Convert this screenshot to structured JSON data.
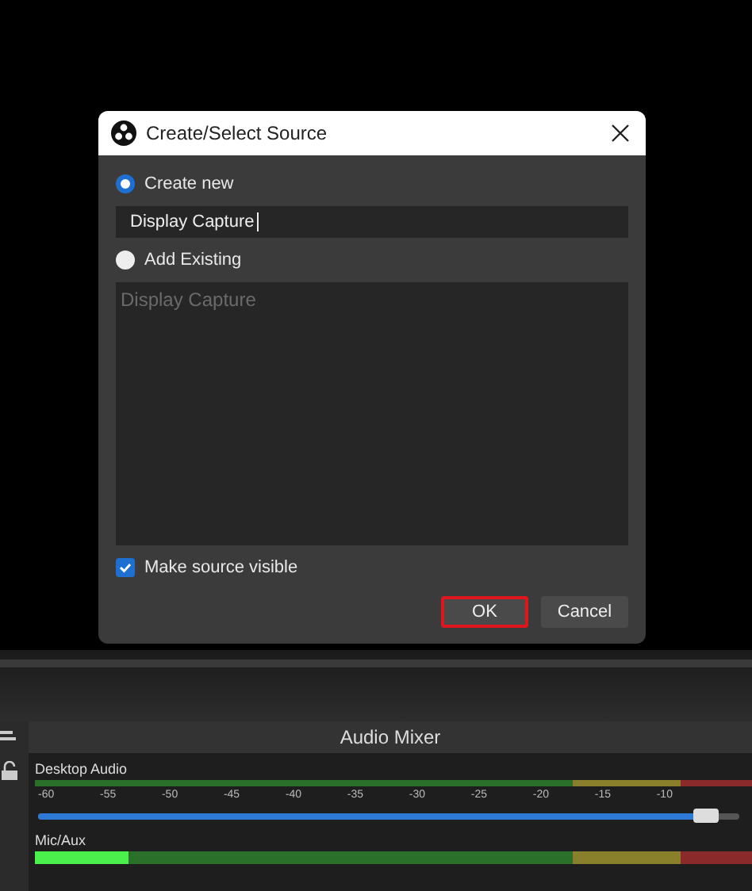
{
  "dialog": {
    "title": "Create/Select Source",
    "options": [
      {
        "label": "Create new",
        "selected": true
      },
      {
        "label": "Add Existing",
        "selected": false
      }
    ],
    "name_field": {
      "value": "Display Capture"
    },
    "existing_list": {
      "disabled": true,
      "items": [
        "Display Capture"
      ]
    },
    "make_visible": {
      "label": "Make source visible",
      "checked": true
    },
    "buttons": [
      {
        "label": "OK",
        "highlighted": true
      },
      {
        "label": "Cancel",
        "highlighted": false
      }
    ]
  },
  "audio_mixer": {
    "title": "Audio Mixer",
    "channels": [
      {
        "name": "Desktop Audio",
        "meter": {
          "level": 0
        },
        "scale": [
          "-60",
          "-55",
          "-50",
          "-45",
          "-40",
          "-35",
          "-30",
          "-25",
          "-20",
          "-15",
          "-10"
        ],
        "fader": {
          "level": 0.97
        }
      },
      {
        "name": "Mic/Aux",
        "meter": {
          "level": 0.13
        }
      }
    ]
  }
}
